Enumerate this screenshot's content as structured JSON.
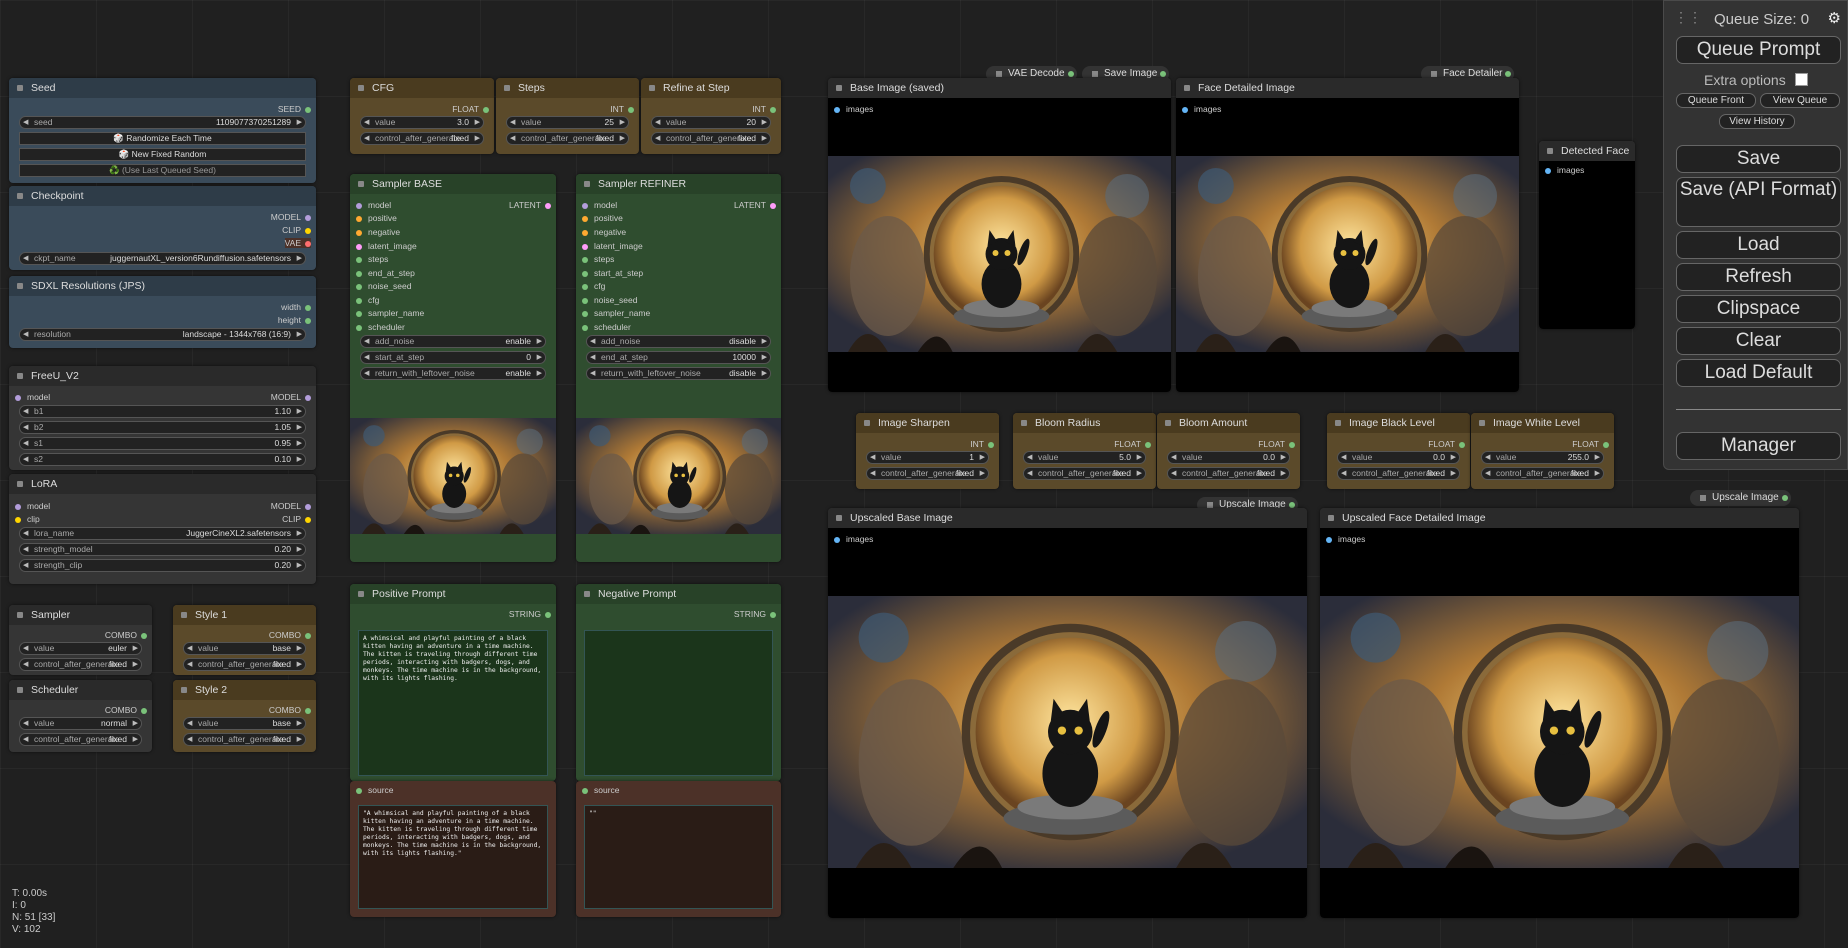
{
  "seed_node": {
    "title": "Seed",
    "out": "SEED",
    "seed_label": "seed",
    "seed_value": "1109077370251289",
    "btn1": "🎲 Randomize Each Time",
    "btn2": "🎲 New Fixed Random",
    "btn3": "♻️ (Use Last Queued Seed)"
  },
  "checkpoint": {
    "title": "Checkpoint",
    "outs": [
      "MODEL",
      "CLIP",
      "VAE"
    ],
    "ckpt_label": "ckpt_name",
    "ckpt_value": "juggernautXL_version6Rundiffusion.safetensors"
  },
  "sdxl": {
    "title": "SDXL Resolutions (JPS)",
    "outs": [
      "width",
      "height"
    ],
    "res_label": "resolution",
    "res_value": "landscape - 1344x768 (16:9)"
  },
  "freeu": {
    "title": "FreeU_V2",
    "in": "model",
    "out": "MODEL",
    "params": [
      {
        "l": "b1",
        "v": "1.10"
      },
      {
        "l": "b2",
        "v": "1.05"
      },
      {
        "l": "s1",
        "v": "0.95"
      },
      {
        "l": "s2",
        "v": "0.10"
      }
    ]
  },
  "lora": {
    "title": "LoRA",
    "ins": [
      "model",
      "clip"
    ],
    "outs": [
      "MODEL",
      "CLIP"
    ],
    "params": [
      {
        "l": "lora_name",
        "v": "JuggerCineXL2.safetensors"
      },
      {
        "l": "strength_model",
        "v": "0.20"
      },
      {
        "l": "strength_clip",
        "v": "0.20"
      }
    ]
  },
  "sampler_sel": {
    "title": "Sampler",
    "out": "COMBO",
    "value_label": "value",
    "value": "euler",
    "cag_label": "control_after_generate",
    "cag": "fixed"
  },
  "scheduler_sel": {
    "title": "Scheduler",
    "out": "COMBO",
    "value_label": "value",
    "value": "normal",
    "cag_label": "control_after_generate",
    "cag": "fixed"
  },
  "style1": {
    "title": "Style 1",
    "out": "COMBO",
    "value_label": "value",
    "value": "base",
    "cag_label": "control_after_generate",
    "cag": "fixed"
  },
  "style2": {
    "title": "Style 2",
    "out": "COMBO",
    "value_label": "value",
    "value": "base",
    "cag_label": "control_after_generate",
    "cag": "fixed"
  },
  "cfg": {
    "title": "CFG",
    "out": "FLOAT",
    "value_label": "value",
    "value": "3.0",
    "cag_label": "control_after_generate",
    "cag": "fixed"
  },
  "steps": {
    "title": "Steps",
    "out": "INT",
    "value_label": "value",
    "value": "25",
    "cag_label": "control_after_generate",
    "cag": "fixed"
  },
  "refine": {
    "title": "Refine at Step",
    "out": "INT",
    "value_label": "value",
    "value": "20",
    "cag_label": "control_after_generate",
    "cag": "fixed"
  },
  "sampler_base": {
    "title": "Sampler BASE",
    "out": "LATENT",
    "ins": [
      "model",
      "positive",
      "negative",
      "latent_image",
      "steps",
      "end_at_step",
      "noise_seed",
      "cfg",
      "sampler_name",
      "scheduler"
    ],
    "params": [
      {
        "l": "add_noise",
        "v": "enable"
      },
      {
        "l": "start_at_step",
        "v": "0"
      },
      {
        "l": "return_with_leftover_noise",
        "v": "enable"
      }
    ]
  },
  "sampler_refiner": {
    "title": "Sampler REFINER",
    "out": "LATENT",
    "ins": [
      "model",
      "positive",
      "negative",
      "latent_image",
      "steps",
      "start_at_step",
      "cfg",
      "noise_seed",
      "sampler_name",
      "scheduler"
    ],
    "params": [
      {
        "l": "add_noise",
        "v": "disable"
      },
      {
        "l": "end_at_step",
        "v": "10000"
      },
      {
        "l": "return_with_leftover_noise",
        "v": "disable"
      }
    ]
  },
  "positive": {
    "title": "Positive Prompt",
    "out": "STRING",
    "text": "A whimsical and playful painting of a black kitten having an adventure in a time machine. The kitten is traveling through different time periods, interacting with badgers, dogs, and monkeys. The time machine is in the background, with its lights flashing.",
    "source_label": "source",
    "source_text": "\"A whimsical and playful painting of a black kitten having an adventure in a time machine. The kitten is traveling through different time periods, interacting with badgers, dogs, and monkeys. The time machine is in the background, with its lights flashing.\""
  },
  "negative": {
    "title": "Negative Prompt",
    "out": "STRING",
    "text": "",
    "source_label": "source",
    "source_text": "\"\""
  },
  "vae_decode": {
    "title": "VAE Decode"
  },
  "save_image": {
    "title": "Save Image"
  },
  "face_detailer": {
    "title": "Face Detailer"
  },
  "base_image": {
    "title": "Base Image (saved)",
    "in": "images"
  },
  "face_image": {
    "title": "Face Detailed Image",
    "in": "images"
  },
  "detected_face": {
    "title": "Detected Face",
    "in": "images"
  },
  "sharpen": {
    "title": "Image Sharpen",
    "out": "INT",
    "value_label": "value",
    "value": "1",
    "cag_label": "control_after_generate",
    "cag": "fixed"
  },
  "bloom_radius": {
    "title": "Bloom Radius",
    "out": "FLOAT",
    "value_label": "value",
    "value": "5.0",
    "cag_label": "control_after_generate",
    "cag": "fixed"
  },
  "bloom_amount": {
    "title": "Bloom Amount",
    "out": "FLOAT",
    "value_label": "value",
    "value": "0.0",
    "cag_label": "control_after_generate",
    "cag": "fixed"
  },
  "black_level": {
    "title": "Image Black Level",
    "out": "FLOAT",
    "value_label": "value",
    "value": "0.0",
    "cag_label": "control_after_generate",
    "cag": "fixed"
  },
  "white_level": {
    "title": "Image White Level",
    "out": "FLOAT",
    "value_label": "value",
    "value": "255.0",
    "cag_label": "control_after_generate",
    "cag": "fixed"
  },
  "upscale_image1": {
    "title": "Upscale Image"
  },
  "upscale_image2": {
    "title": "Upscale Image"
  },
  "upscaled_base": {
    "title": "Upscaled Base Image",
    "in": "images"
  },
  "upscaled_face": {
    "title": "Upscaled Face Detailed Image",
    "in": "images"
  },
  "panel": {
    "queue_size": "Queue Size: 0",
    "queue_prompt": "Queue Prompt",
    "extra_options": "Extra options",
    "queue_front": "Queue Front",
    "view_queue": "View Queue",
    "view_history": "View History",
    "save": "Save",
    "save_api": "Save (API Format)",
    "load": "Load",
    "refresh": "Refresh",
    "clipspace": "Clipspace",
    "clear": "Clear",
    "load_default": "Load Default",
    "manager": "Manager"
  },
  "stats": {
    "t": "T: 0.00s",
    "i": "I: 0",
    "n": "N: 51 [33]",
    "v": "V: 102"
  }
}
